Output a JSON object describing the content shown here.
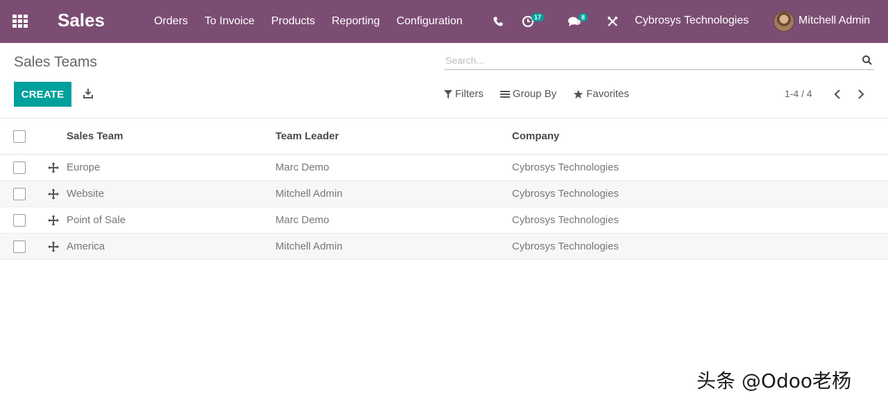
{
  "navbar": {
    "app_title": "Sales",
    "menu": [
      "Orders",
      "To Invoice",
      "Products",
      "Reporting",
      "Configuration"
    ],
    "activity_badge": "17",
    "messages_badge": "8",
    "company": "Cybrosys Technologies",
    "user": "Mitchell Admin",
    "color": "#7c4d73"
  },
  "control_panel": {
    "title": "Sales Teams",
    "search_placeholder": "Search...",
    "create_label": "CREATE",
    "filters_label": "Filters",
    "group_by_label": "Group By",
    "favorites_label": "Favorites",
    "pager": "1-4 / 4",
    "accent_color": "#00a09d"
  },
  "list": {
    "columns": [
      "Sales Team",
      "Team Leader",
      "Company"
    ],
    "rows": [
      {
        "team": "Europe",
        "leader": "Marc Demo",
        "company": "Cybrosys Technologies"
      },
      {
        "team": "Website",
        "leader": "Mitchell Admin",
        "company": "Cybrosys Technologies"
      },
      {
        "team": "Point of Sale",
        "leader": "Marc Demo",
        "company": "Cybrosys Technologies"
      },
      {
        "team": "America",
        "leader": "Mitchell Admin",
        "company": "Cybrosys Technologies"
      }
    ]
  },
  "icons": [
    "apps-grid-icon",
    "phone-icon",
    "activity-clock-icon",
    "chat-icon",
    "tools-icon",
    "search-icon",
    "download-icon",
    "filter-icon",
    "group-by-icon",
    "star-icon",
    "chevron-left-icon",
    "chevron-right-icon",
    "drag-handle-icon"
  ],
  "watermark": "头条 @Odoo老杨"
}
